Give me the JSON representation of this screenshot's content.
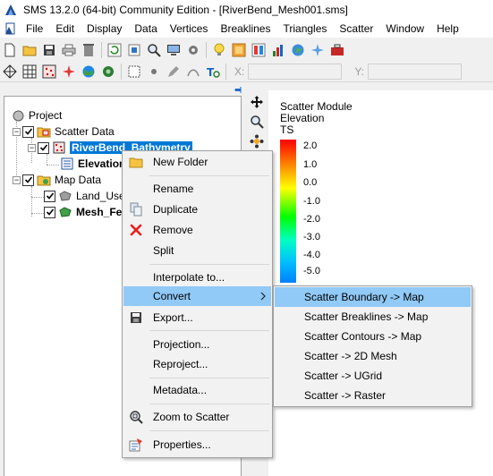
{
  "window": {
    "title": "SMS 13.2.0 (64-bit) Community Edition - [RiverBend_Mesh001.sms]"
  },
  "menubar": {
    "items": [
      "File",
      "Edit",
      "Display",
      "Data",
      "Vertices",
      "Breaklines",
      "Triangles",
      "Scatter",
      "Window",
      "Help"
    ]
  },
  "coords": {
    "x_label": "X:",
    "y_label": "Y:"
  },
  "tree": {
    "project": "Project",
    "scatter_data": "Scatter Data",
    "bathymetry": "RiverBend_Bathymetry",
    "elevation": "Elevation",
    "map_data": "Map Data",
    "land_use": "Land_Use",
    "mesh_feature": "Mesh_Fe"
  },
  "legend": {
    "title_lines": [
      "Scatter Module",
      "Elevation",
      "TS"
    ],
    "ticks": [
      "2.0",
      "1.0",
      "0.0",
      "-1.0",
      "-2.0",
      "-3.0",
      "-4.0",
      "-5.0"
    ],
    "colors": [
      "#ff0000",
      "#ff8000",
      "#ffff00",
      "#00ff00",
      "#00ffc0",
      "#00c0ff",
      "#0080ff"
    ]
  },
  "context_menu": {
    "items": [
      {
        "label": "New Folder",
        "icon": "folder-icon"
      },
      {
        "label": "Rename",
        "icon": ""
      },
      {
        "label": "Duplicate",
        "icon": "duplicate-icon"
      },
      {
        "label": "Remove",
        "icon": "remove-x-icon"
      },
      {
        "label": "Split",
        "icon": ""
      },
      {
        "label": "Interpolate to...",
        "icon": ""
      },
      {
        "label": "Convert",
        "icon": "",
        "submenu": true,
        "highlighted": true
      },
      {
        "label": "Export...",
        "icon": "save-disk-icon"
      },
      {
        "label": "Projection...",
        "icon": ""
      },
      {
        "label": "Reproject...",
        "icon": ""
      },
      {
        "label": "Metadata...",
        "icon": ""
      },
      {
        "label": "Zoom to Scatter",
        "icon": "zoom-icon"
      },
      {
        "label": "Properties...",
        "icon": "properties-icon"
      }
    ]
  },
  "convert_submenu": {
    "items": [
      {
        "label": "Scatter Boundary -> Map",
        "highlighted": true
      },
      {
        "label": "Scatter Breaklines -> Map"
      },
      {
        "label": "Scatter Contours -> Map"
      },
      {
        "label": "Scatter -> 2D Mesh"
      },
      {
        "label": "Scatter -> UGrid"
      },
      {
        "label": "Scatter -> Raster"
      }
    ]
  },
  "colors": {
    "selection": "#0078d7",
    "menu_highlight": "#91c9f7",
    "menu_background": "#f2f2f2"
  }
}
